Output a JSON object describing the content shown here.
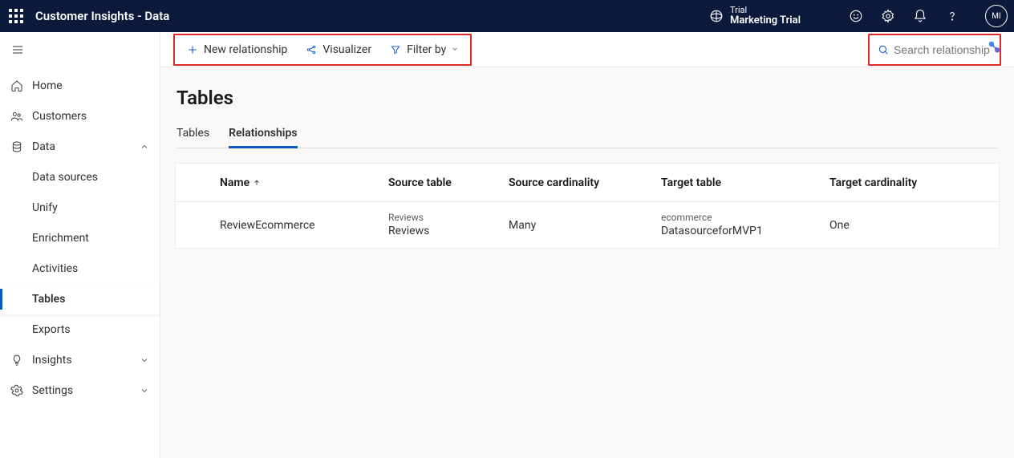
{
  "header": {
    "app_title": "Customer Insights - Data",
    "trial_small": "Trial",
    "trial_large": "Marketing Trial",
    "avatar_initials": "MI"
  },
  "sidebar": {
    "items": {
      "home": "Home",
      "customers": "Customers",
      "data": "Data",
      "insights": "Insights",
      "settings": "Settings"
    },
    "data_sub": {
      "data_sources": "Data sources",
      "unify": "Unify",
      "enrichment": "Enrichment",
      "activities": "Activities",
      "tables": "Tables",
      "exports": "Exports"
    }
  },
  "toolbar": {
    "new_relationship": "New relationship",
    "visualizer": "Visualizer",
    "filter_by": "Filter by",
    "search_placeholder": "Search relationships"
  },
  "page": {
    "title": "Tables"
  },
  "tabs": {
    "tables": "Tables",
    "relationships": "Relationships"
  },
  "table": {
    "headers": {
      "name": "Name",
      "source_table": "Source table",
      "source_cardinality": "Source cardinality",
      "target_table": "Target table",
      "target_cardinality": "Target cardinality"
    },
    "rows": [
      {
        "name": "ReviewEcommerce",
        "source_table_sub": "Reviews",
        "source_table_main": "Reviews",
        "source_cardinality": "Many",
        "target_table_sub": "ecommerce",
        "target_table_main": "DatasourceforMVP1",
        "target_cardinality": "One"
      }
    ]
  }
}
